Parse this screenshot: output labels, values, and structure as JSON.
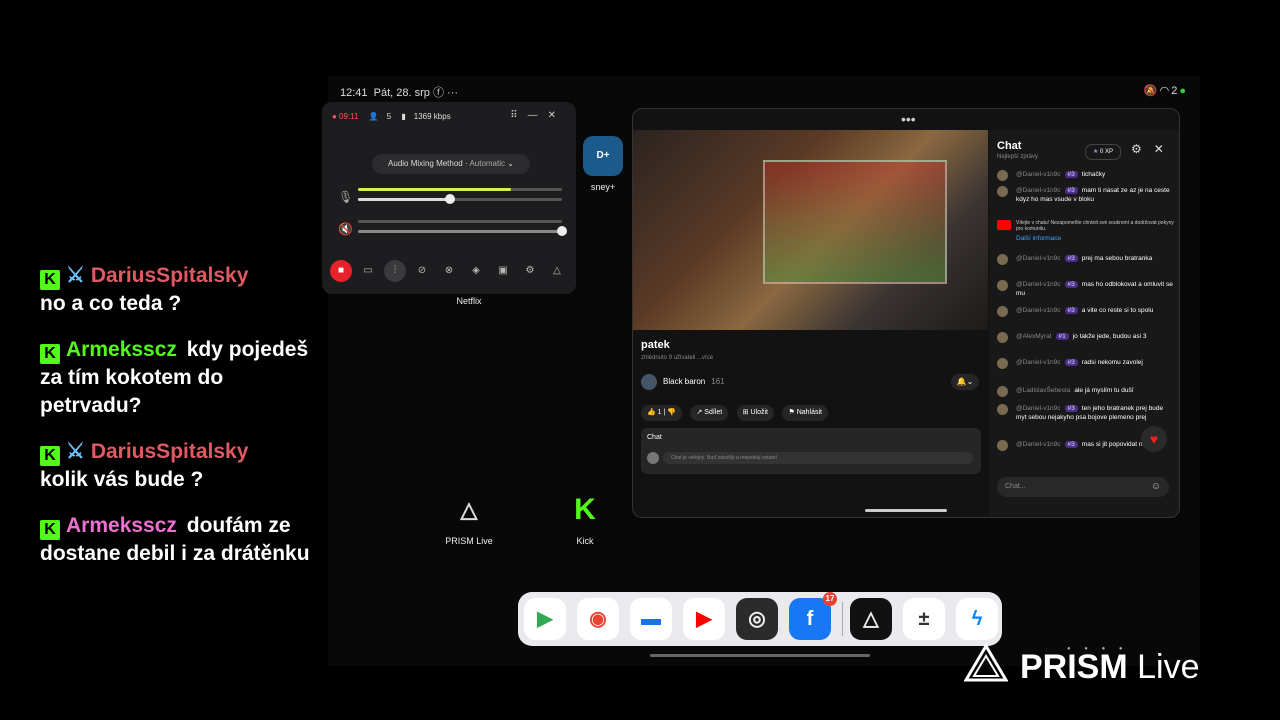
{
  "overlay_chat": [
    {
      "platform": "kick",
      "sword": true,
      "user": "DariusSpitalsky",
      "user_color": "#e05a63",
      "text": "no a co teda ?"
    },
    {
      "platform": "kick",
      "sword": false,
      "user": "Armeksscz",
      "user_color": "#53fc18",
      "text": "kdy pojedeš za tím kokotem do petrvadu?"
    },
    {
      "platform": "kick",
      "sword": true,
      "user": "DariusSpitalsky",
      "user_color": "#e05a63",
      "text": "kolik vás bude ?"
    },
    {
      "platform": "kick",
      "sword": false,
      "user": "Armeksscz",
      "user_color": "#ee6fd1",
      "text": "doufám ze dostane debil i za drátěnku"
    }
  ],
  "statusbar": {
    "time": "12:41",
    "date": "Pát, 28. srp",
    "right": "2"
  },
  "mixer": {
    "timer": "● 09:11",
    "viewers": "5",
    "bitrate": "1369 kbps",
    "method_label": "Audio Mixing Method",
    "method_value": "Automatic",
    "mic_level": 0.75,
    "mic_knob": 0.45,
    "system_level": 1.0
  },
  "home_apps": [
    {
      "label": "sney+"
    },
    {
      "label": "Netflix"
    },
    {
      "label": "PRISM Live"
    },
    {
      "label": "Kick"
    }
  ],
  "youtube": {
    "title": "patek",
    "subtitle": "zhlédnuto 9 uživateli ...více",
    "channel": "Black baron",
    "subs": "161",
    "likes": "1",
    "share": "Sdílet",
    "save": "Uložit",
    "report": "Nahlásit",
    "chat_label": "Chat",
    "chat_placeholder": "Chat je veřejný. Buď zdvořilý a respektuj ostatní"
  },
  "livechat": {
    "title": "Chat",
    "subtitle": "Nejlepší zprávy",
    "xp": "0 XP",
    "info_link": "Další informace",
    "notice": "Vítejte v chatu! Nezapomeňte chránit své soukromí a dodržovat pokyny pro komunitu.",
    "input_placeholder": "Chat...",
    "messages": [
      {
        "name": "@Daniel-v1n9c",
        "badge": "#3",
        "text": "tichačky"
      },
      {
        "name": "@Daniel-v1n9c",
        "badge": "#3",
        "text": "mam ti nasat ze az je na ceste kdyz ho mas vsude v bloku"
      },
      {
        "name": "@Daniel-v1n9c",
        "badge": "#3",
        "text": "prej ma sebou bratranka"
      },
      {
        "name": "@Daniel-v1n9c",
        "badge": "#3",
        "text": "mas ho odblokovat a omluvit se mu"
      },
      {
        "name": "@Daniel-v1n9c",
        "badge": "#3",
        "text": "a vite co reste si to spolu"
      },
      {
        "name": "@AlexMyrat",
        "badge": "#1",
        "text": "jo takže jede, budou asi 3"
      },
      {
        "name": "@Daniel-v1n9c",
        "badge": "#3",
        "text": "radsi nekomu zavolej"
      },
      {
        "name": "@LadislavŠebesta",
        "badge": "",
        "text": "ale já myslím tu dušî"
      },
      {
        "name": "@Daniel-v1n9c",
        "badge": "#3",
        "text": "ten jeho bratranek prej bude myt sebou nejakyho psa bojove plemeno prej"
      },
      {
        "name": "@Daniel-v1n9c",
        "badge": "#3",
        "text": "mas si jit popovidat na kick"
      }
    ]
  },
  "dock": {
    "facebook_badge": "17"
  },
  "watermark": {
    "brand": "PRISM",
    "suffix": "Live"
  }
}
